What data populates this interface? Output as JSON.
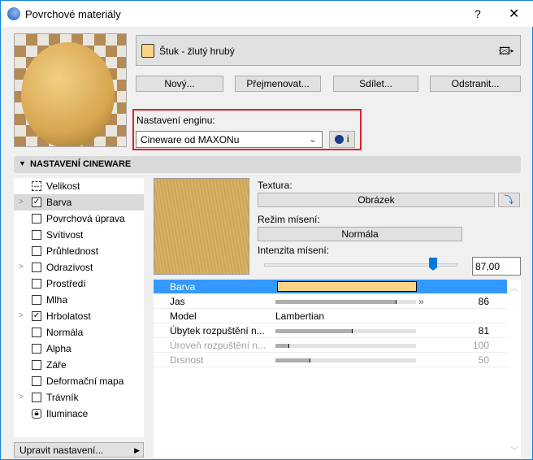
{
  "window": {
    "title": "Povrchové materiály",
    "help": "?",
    "close": "✕"
  },
  "material": {
    "name": "Štuk - žlutý hrubý",
    "swatch_color": "#fdd385"
  },
  "buttons": {
    "new": "Nový...",
    "rename": "Přejmenovat...",
    "share": "Sdílet...",
    "delete": "Odstranit..."
  },
  "engine": {
    "label": "Nastavení enginu:",
    "value": "Cineware od MAXONu",
    "info": "i"
  },
  "section": {
    "title": "NASTAVENÍ CINEWARE"
  },
  "channels": [
    {
      "label": "Velikost",
      "type": "size",
      "expand": false
    },
    {
      "label": "Barva",
      "checked": true,
      "expand": true,
      "selected": true
    },
    {
      "label": "Povrchová úprava",
      "checked": false
    },
    {
      "label": "Svítivost",
      "checked": false
    },
    {
      "label": "Průhlednost",
      "checked": false
    },
    {
      "label": "Odrazivost",
      "checked": false,
      "expand": true
    },
    {
      "label": "Prostředí",
      "checked": false
    },
    {
      "label": "Mlha",
      "checked": false
    },
    {
      "label": "Hrbolatost",
      "checked": true,
      "expand": true
    },
    {
      "label": "Normála",
      "checked": false
    },
    {
      "label": "Alpha",
      "checked": false
    },
    {
      "label": "Záře",
      "checked": false
    },
    {
      "label": "Deformační mapa",
      "checked": false
    },
    {
      "label": "Trávník",
      "checked": false,
      "expand": true
    },
    {
      "label": "Iluminace",
      "type": "lock"
    }
  ],
  "edit_settings": "Upravit nastavení...",
  "texture": {
    "label": "Textura:",
    "value": "Obrázek",
    "blend_label": "Režim mísení:",
    "blend_value": "Normála",
    "intensity_label": "Intenzita mísení:",
    "intensity_value": "87,00",
    "intensity_percent": 87
  },
  "properties": [
    {
      "name": "Barva",
      "color": "#fdd385"
    },
    {
      "name": "Jas",
      "bar": 86,
      "value": "86"
    },
    {
      "name": "Model",
      "text": "Lambertian"
    },
    {
      "name": "Úbytek rozpuštění n...",
      "bar": 55,
      "value": "81"
    },
    {
      "name": "Úroveň rozpuštění n...",
      "bar": 10,
      "value": "100",
      "disabled": true
    },
    {
      "name": "Drsnost",
      "bar": 25,
      "value": "50",
      "disabled": true
    }
  ]
}
